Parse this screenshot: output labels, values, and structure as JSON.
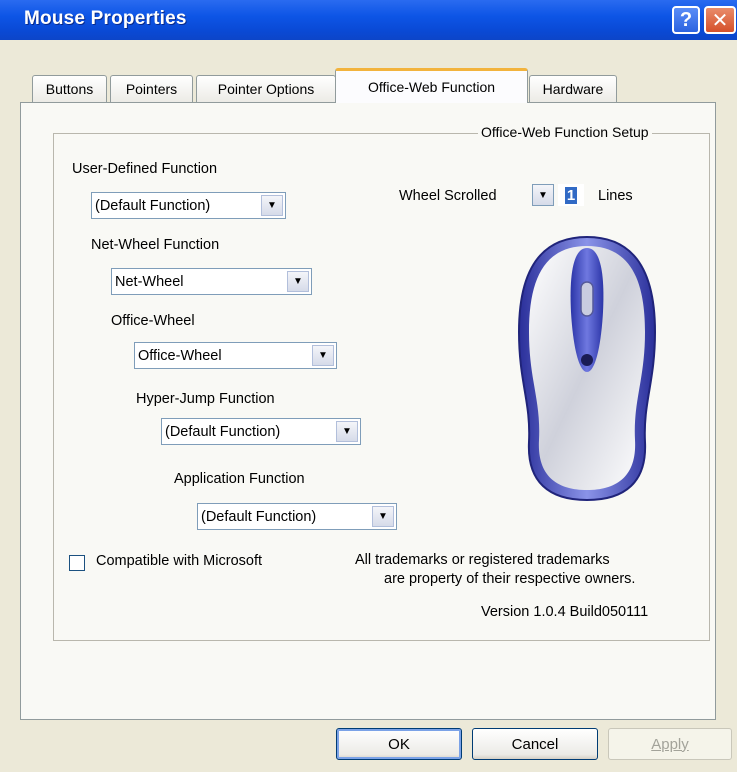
{
  "window": {
    "title": "Mouse Properties"
  },
  "title_buttons": {
    "help": "?",
    "close": "✕"
  },
  "tabs": [
    {
      "label": "Buttons"
    },
    {
      "label": "Pointers"
    },
    {
      "label": "Pointer Options"
    },
    {
      "label": "Office-Web Function",
      "active": true
    },
    {
      "label": "Hardware"
    }
  ],
  "group": {
    "title": "Office-Web Function Setup"
  },
  "functions": {
    "user_defined": {
      "label": "User-Defined Function",
      "value": "(Default Function)"
    },
    "net_wheel": {
      "label": "Net-Wheel Function",
      "value": "Net-Wheel"
    },
    "office_wheel": {
      "label": "Office-Wheel",
      "value": "Office-Wheel"
    },
    "hyper_jump": {
      "label": "Hyper-Jump Function",
      "value": "(Default Function)"
    },
    "application": {
      "label": "Application Function",
      "value": "(Default Function)"
    }
  },
  "wheel": {
    "label": "Wheel Scrolled",
    "value": "1",
    "unit": "Lines"
  },
  "compat": {
    "label": "Compatible with Microsoft",
    "checked": false
  },
  "trademark": {
    "line1": "All trademarks or registered trademarks",
    "line2": "are property of their respective owners."
  },
  "version": "Version 1.0.4 Build050111",
  "buttons": {
    "ok": "OK",
    "cancel": "Cancel",
    "apply": "Apply"
  },
  "icons": {
    "dropdown": "chevron-down-icon",
    "help": "help-icon",
    "close": "close-icon",
    "mouse": "mouse-illustration"
  },
  "colors": {
    "titlebar": "#0d55e6",
    "tab_highlight": "#f2b33d",
    "mouse_blue": "#3a44b8"
  }
}
